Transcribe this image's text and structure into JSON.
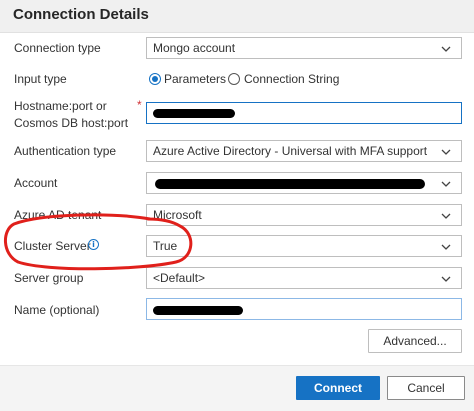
{
  "header": {
    "title": "Connection Details"
  },
  "form": {
    "connection_type": {
      "label": "Connection type",
      "value": "Mongo account"
    },
    "input_type": {
      "label": "Input type",
      "options": [
        "Parameters",
        "Connection String"
      ],
      "selected": "Parameters"
    },
    "hostname": {
      "label_line1": "Hostname:port or",
      "label_line2": "Cosmos DB host:port",
      "required_mark": "*"
    },
    "authentication_type": {
      "label": "Authentication type",
      "value": "Azure Active Directory - Universal with MFA support"
    },
    "account": {
      "label": "Account"
    },
    "azure_ad_tenant": {
      "label": "Azure AD tenant",
      "value": "Microsoft"
    },
    "cluster_server": {
      "label": "Cluster Server",
      "value": "True",
      "info_icon": "info-icon"
    },
    "server_group": {
      "label": "Server group",
      "value": "<Default>"
    },
    "name": {
      "label": "Name (optional)"
    }
  },
  "buttons": {
    "advanced": "Advanced...",
    "connect": "Connect",
    "cancel": "Cancel"
  },
  "colors": {
    "accent": "#1672c4",
    "annotation_circle": "#e0201b",
    "redaction": "#000000"
  },
  "icons": [
    "chevron-down-icon",
    "info-icon"
  ]
}
